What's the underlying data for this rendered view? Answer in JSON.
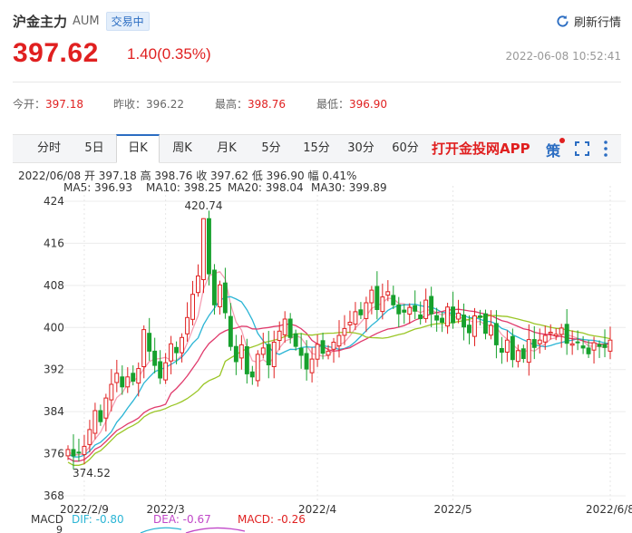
{
  "header": {
    "name": "沪金主力",
    "code": "AUM",
    "status": "交易中",
    "refresh_label": "刷新行情"
  },
  "quote": {
    "price": "397.62",
    "change": "1.40(0.35%)",
    "timestamp": "2022-06-08 10:52:41"
  },
  "stats": [
    {
      "label": "今开：",
      "value": "397.18"
    },
    {
      "label": "昨收：",
      "value": "396.22"
    },
    {
      "label": "最高：",
      "value": "398.76"
    },
    {
      "label": "最低：",
      "value": "396.90"
    }
  ],
  "tabs": [
    "分时",
    "5日",
    "日K",
    "周K",
    "月K",
    "5分",
    "15分",
    "30分",
    "60分"
  ],
  "active_tab": "日K",
  "app_link": "打开金投网APP",
  "toolbar_icon_text": "策",
  "ohlc_line": "2022/06/08  开 397.18  高 398.76  收 397.62  低 396.90  幅 0.41%",
  "ma_legend": [
    {
      "label": "MA5: 396.93",
      "color": "#f5a0b4"
    },
    {
      "label": "MA10: 398.25",
      "color": "#2bb5d5"
    },
    {
      "label": "MA20: 398.04",
      "color": "#e0396b"
    },
    {
      "label": "MA30: 399.89",
      "color": "#9ac626"
    }
  ],
  "macd": {
    "title": "MACD",
    "dif": "DIF: -0.80",
    "dea": "DEA: -0.67",
    "macd": "MACD: -0.26",
    "axis_top": "9"
  },
  "colors": {
    "up": "#e02020",
    "down": "#17a12d",
    "accent": "#2b6dc2"
  },
  "chart_data": {
    "type": "candlestick",
    "y_ticks": [
      368,
      376,
      384,
      392,
      400,
      408,
      416,
      424
    ],
    "ylim": [
      368,
      424
    ],
    "x_labels": [
      {
        "index": 3,
        "label": "2022/2/9"
      },
      {
        "index": 18,
        "label": "2022/3"
      },
      {
        "index": 46,
        "label": "2022/4"
      },
      {
        "index": 71,
        "label": "2022/5"
      },
      {
        "index": 100,
        "label": "2022/6/8"
      }
    ],
    "annotations": [
      {
        "index": 25,
        "value": 420.74,
        "label": "420.74"
      },
      {
        "index": 2,
        "value": 374.52,
        "label": "374.52"
      }
    ],
    "close": [
      376.8,
      375.6,
      376.2,
      377.4,
      380.6,
      384.2,
      382.1,
      386.6,
      389.2,
      391.3,
      388.7,
      390.6,
      389.8,
      392.2,
      399.6,
      395.5,
      392.8,
      390.4,
      393.3,
      396.9,
      395.2,
      398.1,
      401.9,
      406.3,
      409.8,
      420.7,
      410.2,
      404.3,
      408.1,
      402.8,
      396.4,
      393.5,
      396.7,
      391.2,
      390.6,
      394.9,
      396.1,
      392.9,
      397.2,
      399.3,
      401.6,
      398.1,
      396.4,
      394.7,
      392.1,
      394.0,
      396.8,
      395.1,
      395.5,
      397.2,
      398.5,
      399.8,
      401.0,
      403.0,
      402.4,
      404.7,
      407.1,
      403.4,
      405.8,
      406.8,
      404.3,
      402.6,
      402.9,
      403.8,
      403.1,
      401.7,
      405.2,
      402.6,
      401.4,
      401.0,
      403.9,
      400.9,
      402.7,
      400.1,
      399.0,
      402.2,
      401.9,
      398.9,
      400.4,
      396.7,
      395.3,
      397.6,
      393.9,
      395.6,
      394.1,
      397.7,
      396.2,
      397.6,
      398.5,
      399.1,
      398.7,
      399.9,
      397.0,
      396.9,
      397.2,
      396.1,
      395.0,
      397.1,
      396.4,
      396.2,
      397.6
    ]
  }
}
